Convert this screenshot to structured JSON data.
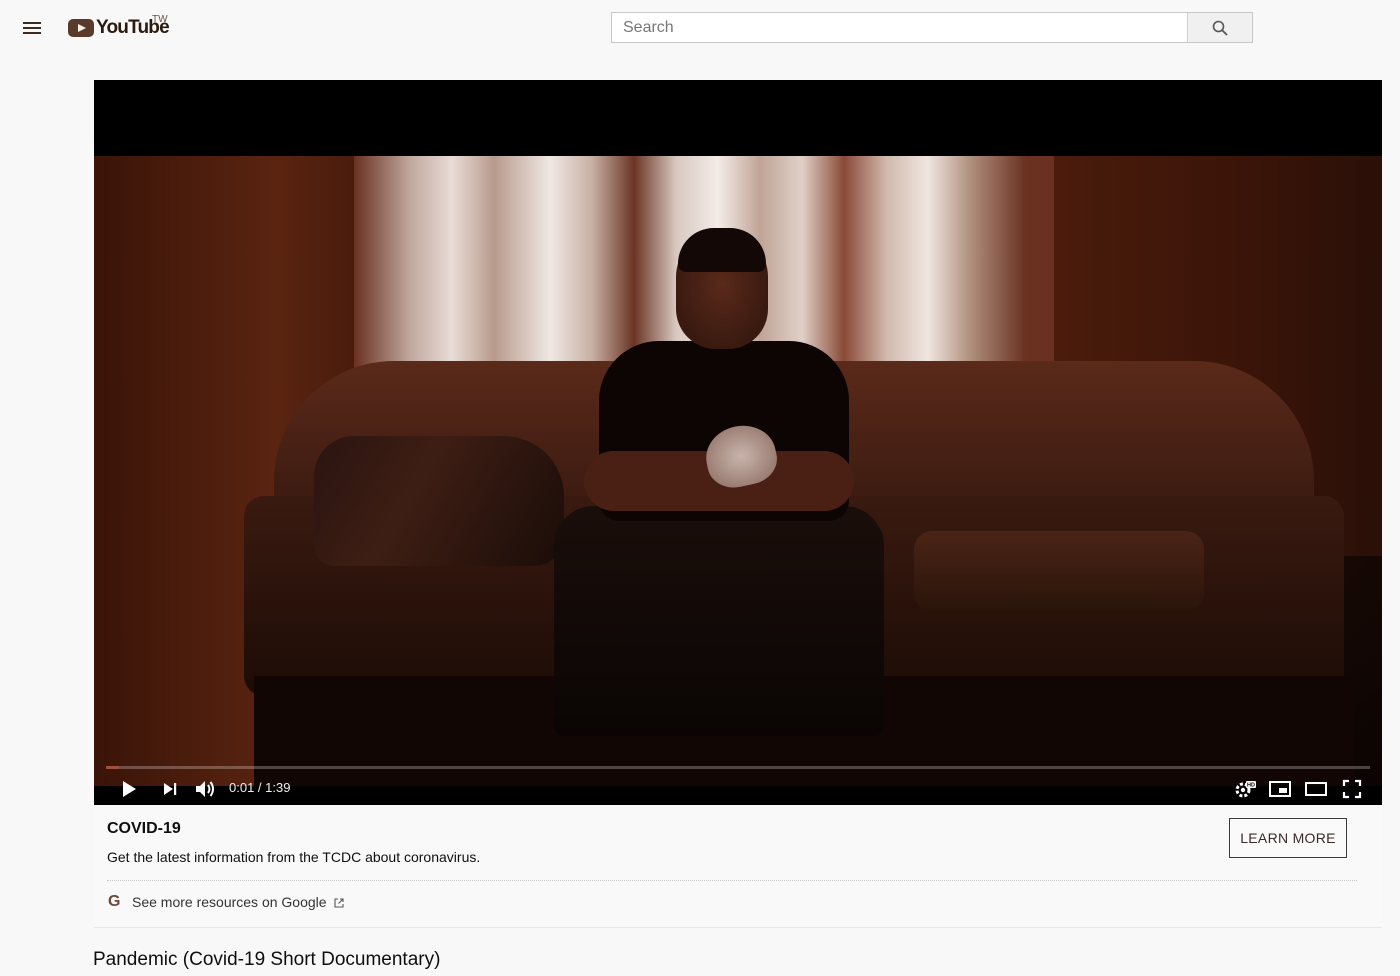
{
  "header": {
    "logo_text": "YouTube",
    "logo_region": "TW",
    "search_placeholder": "Search",
    "icons": [
      "menu-icon",
      "youtube-logo",
      "search-icon"
    ]
  },
  "player": {
    "current_time": "0:01",
    "duration": "1:39",
    "time_display": "0:01 / 1:39",
    "progress_fraction": 0.01,
    "quality_badge": "HD",
    "icons": [
      "play-icon",
      "next-icon",
      "volume-icon",
      "settings-icon",
      "miniplayer-icon",
      "theater-icon",
      "fullscreen-icon"
    ]
  },
  "info_panel": {
    "title": "COVID-19",
    "description": "Get the latest information from the TCDC about coronavirus.",
    "button_label": "LEARN MORE",
    "link_text": "See more resources on Google",
    "google_letter": "G"
  },
  "video": {
    "title": "Pandemic (Covid-19 Short Documentary)"
  },
  "colors": {
    "page_bg": "#f8f8f8",
    "player_bg": "#000000",
    "progress": "#a05040"
  }
}
